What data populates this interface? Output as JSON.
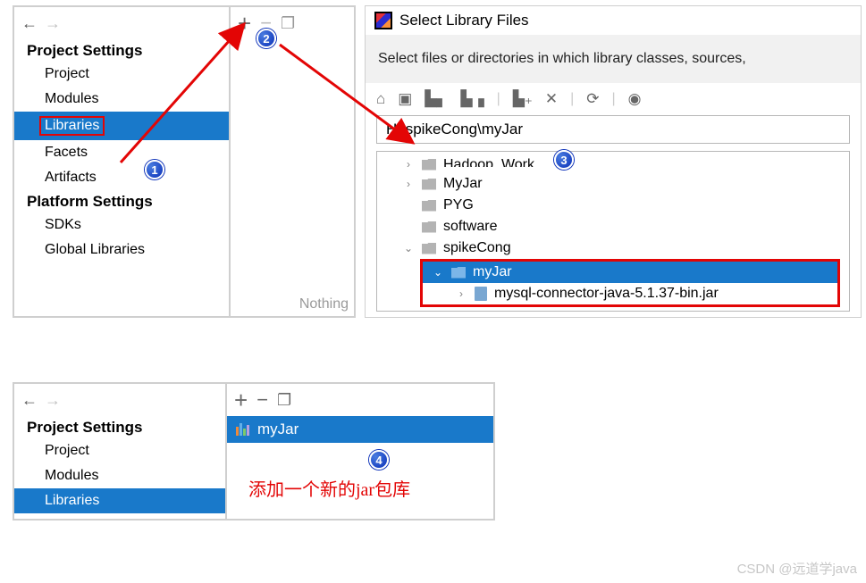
{
  "settings": {
    "project_header": "Project Settings",
    "platform_header": "Platform Settings",
    "items_project": [
      "Project",
      "Modules",
      "Libraries",
      "Facets",
      "Artifacts"
    ],
    "items_platform": [
      "SDKs",
      "Global Libraries"
    ],
    "selected": "Libraries"
  },
  "midpanel": {
    "nothing": "Nothing"
  },
  "dialog": {
    "title": "Select Library Files",
    "instruction": "Select files or directories in which library classes, sources,",
    "path": "H:\\spikeCong\\myJar",
    "tree": [
      {
        "label": "Hadoop_Work",
        "indent": 1,
        "chev": ">",
        "cut": true
      },
      {
        "label": "MyJar",
        "indent": 1,
        "chev": "›"
      },
      {
        "label": "PYG",
        "indent": 1
      },
      {
        "label": "software",
        "indent": 1
      },
      {
        "label": "spikeCong",
        "indent": 1,
        "chev": "⌄"
      }
    ],
    "selected_folder": "myJar",
    "jar_file": "mysql-connector-java-5.1.37-bin.jar"
  },
  "bottom": {
    "lib_name": "myJar",
    "note": "添加一个新的jar包库"
  },
  "watermark": "CSDN @远道学java",
  "badges": {
    "b1": "1",
    "b2": "2",
    "b3": "3",
    "b4": "4"
  }
}
